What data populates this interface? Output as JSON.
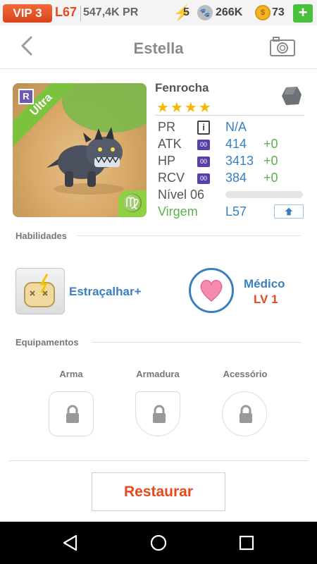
{
  "status": {
    "vip": "VIP 3",
    "level": "L67",
    "power": "547,4K PR",
    "energy": "5",
    "paw_points": "266K",
    "coins": "73",
    "add_label": "+"
  },
  "header": {
    "title": "Estella"
  },
  "pet": {
    "name": "Fenrocha",
    "stars": "★★★★",
    "rarity": "Ultra",
    "rank_badge": "R",
    "zodiac_symbol": "♍",
    "stats": [
      {
        "label": "PR",
        "value": "N/A",
        "bonus": ""
      },
      {
        "label": "ATK",
        "value": "414",
        "bonus": "+0"
      },
      {
        "label": "HP",
        "value": "3413",
        "bonus": "+0"
      },
      {
        "label": "RCV",
        "value": "384",
        "bonus": "+0"
      }
    ],
    "info_icon_text": "i",
    "stat_icon_text": "00",
    "level_label": "Nível 06",
    "level_progress": 0,
    "zodiac": "Virgem",
    "zodiac_level": "L57"
  },
  "skills": {
    "section_label": "Habilidades",
    "active_name": "Estraçalhar+",
    "passive_name": "Médico",
    "passive_level": "LV 1"
  },
  "equipment": {
    "section_label": "Equipamentos",
    "slots": [
      "Arma",
      "Armadura",
      "Acessório"
    ]
  },
  "actions": {
    "restore_label": "Restaurar"
  },
  "colors": {
    "accent_orange": "#e8481a",
    "accent_blue": "#3a7fc2",
    "bonus_green": "#5ab34a"
  }
}
